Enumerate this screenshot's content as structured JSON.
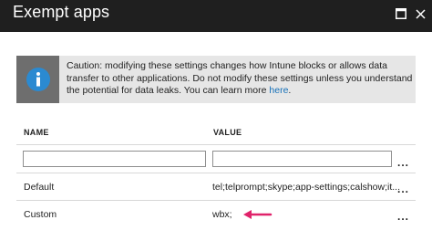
{
  "window": {
    "title": "Exempt apps",
    "maximize_icon": "maximize-icon",
    "close_icon": "close-icon"
  },
  "banner": {
    "icon": "info-icon",
    "text": "Caution: modifying these settings changes how Intune blocks or allows data transfer to other applications. Do not modify these settings unless you understand the potential for data leaks. You can learn more ",
    "link_text": "here",
    "end_punct": "."
  },
  "table": {
    "headers": {
      "name": "NAME",
      "value": "VALUE"
    },
    "new_row": {
      "name_value": "",
      "value_value": "",
      "menu": "..."
    },
    "rows": [
      {
        "name": "Default",
        "value": "tel;telprompt;skype;app-settings;calshow;it...",
        "menu": "..."
      },
      {
        "name": "Custom",
        "value": "wbx;",
        "menu": "..."
      }
    ]
  },
  "colors": {
    "titlebar": "#1f1f1f",
    "banner_bg": "#e6e6e6",
    "info_icon_bg": "#6e6e6e",
    "info_icon_circle": "#2b8ad1",
    "link": "#1570b8",
    "annotation_arrow": "#e0226a"
  }
}
